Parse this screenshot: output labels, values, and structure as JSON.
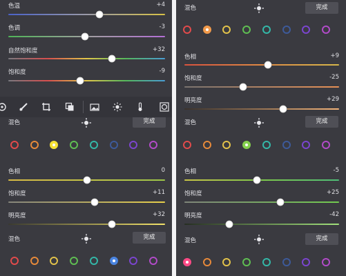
{
  "top_left": {
    "rows": [
      {
        "label": "色温",
        "value": "+4",
        "level": 0.58,
        "gradient": "linear-gradient(90deg,#4a62c9,#9a9aa8,#d8c247)"
      },
      {
        "label": "色调",
        "value": "-3",
        "level": 0.49,
        "gradient": "linear-gradient(90deg,#4fb457,#a0a0a0,#b46fd6)"
      },
      {
        "label": "自然饱和度",
        "value": "+32",
        "level": 0.66,
        "gradient": "linear-gradient(90deg,#7a7a80,#d94e4e,#e3c84a,#55b95c,#4a9ed6)"
      },
      {
        "label": "饱和度",
        "value": "-9",
        "level": 0.46,
        "gradient": "linear-gradient(90deg,#7a7a80,#d94e4e,#e3c84a,#55b95c,#4a9ed6)"
      }
    ]
  },
  "toolbar": {
    "tools": [
      "adjust-icon",
      "brush-icon",
      "crop-icon",
      "layers-icon",
      "image-icon",
      "sun-icon",
      "thermometer-icon",
      "vignette-icon"
    ]
  },
  "mid_left": {
    "mix_label": "混色",
    "done_label": "完成",
    "selected_swatch": 2,
    "rows": [
      {
        "label": "色相",
        "value": "0",
        "level": 0.5,
        "gradient": "linear-gradient(90deg,#d9bb45,#c4c447,#9dc748)"
      },
      {
        "label": "饱和度",
        "value": "+11",
        "level": 0.55,
        "gradient": "linear-gradient(90deg,#85857c,#e8d04a)"
      },
      {
        "label": "明亮度",
        "value": "+32",
        "level": 0.66,
        "gradient": "linear-gradient(90deg,#3a3a30,#f4e46a)"
      }
    ],
    "mix2_label": "混色",
    "done2_label": "完成",
    "selected_swatch2": 5
  },
  "top_right": {
    "mix_label": "混色",
    "done_label": "完成",
    "selected_swatch": 1,
    "rows": [
      {
        "label": "色相",
        "value": "+9",
        "level": 0.54,
        "gradient": "linear-gradient(90deg,#d9533e,#e08a44,#d7b84a)"
      },
      {
        "label": "饱和度",
        "value": "-25",
        "level": 0.38,
        "gradient": "linear-gradient(90deg,#7a7470,#e89156)"
      },
      {
        "label": "明亮度",
        "value": "+29",
        "level": 0.64,
        "gradient": "linear-gradient(90deg,#3a322c,#f5b57a)"
      }
    ]
  },
  "bottom_right": {
    "mix_label": "混色",
    "done_label": "完成",
    "selected_swatch": 3,
    "rows": [
      {
        "label": "色相",
        "value": "-5",
        "level": 0.47,
        "gradient": "linear-gradient(90deg,#c9c546,#7ec84b,#4fbf78)"
      },
      {
        "label": "饱和度",
        "value": "+25",
        "level": 0.62,
        "gradient": "linear-gradient(90deg,#7f857a,#72cc4f)"
      },
      {
        "label": "明亮度",
        "value": "-42",
        "level": 0.29,
        "gradient": "linear-gradient(90deg,#262e22,#a2e27c)"
      }
    ],
    "mix2_label": "混色",
    "done2_label": "完成",
    "selected_swatch2": 0
  },
  "swatch_colors": [
    "#e24b4b",
    "#e88a3a",
    "#e3c34a",
    "#5fbf52",
    "#33b8a8",
    "#3d5a9a",
    "#7b45cf",
    "#b24bc9"
  ],
  "selected_fills": [
    "#ff4a86",
    "#f29a4b",
    "#f6e234",
    "#84d04d",
    "#33b8a8",
    "#4a84e0",
    "#7b45cf",
    "#b24bc9"
  ]
}
